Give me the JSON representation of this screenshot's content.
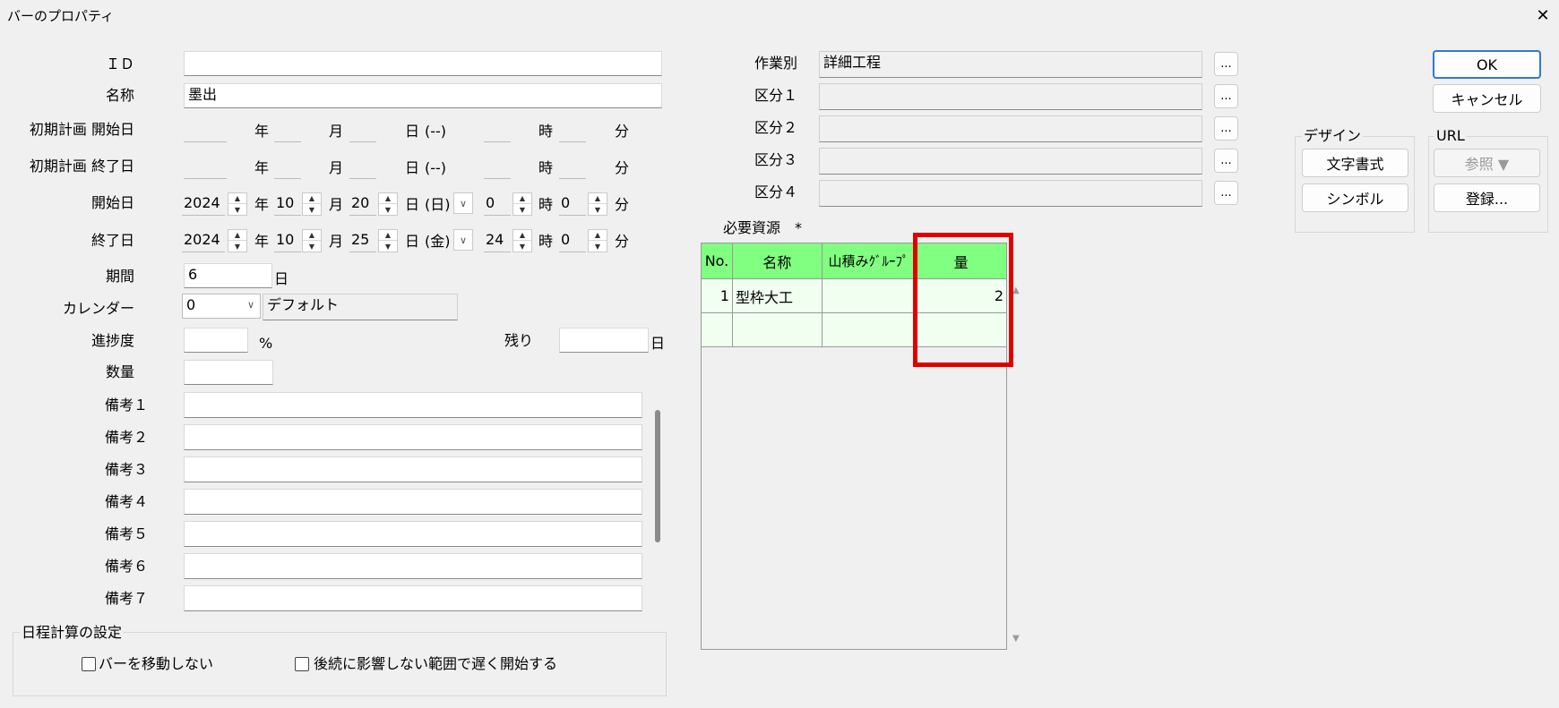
{
  "window": {
    "title": "バーのプロパティ",
    "close_glyph": "✕"
  },
  "left": {
    "id_label": "ＩＤ",
    "id_value": "",
    "name_label": "名称",
    "name_value": "墨出",
    "initial_start_label": "初期計画 開始日",
    "initial_end_label": "初期計画 終了日",
    "start_label": "開始日",
    "end_label": "終了日",
    "unit_year": "年",
    "unit_month": "月",
    "unit_day": "日",
    "unit_hour": "時",
    "unit_min": "分",
    "weekday_empty": "(--)",
    "start": {
      "year": "2024",
      "month": "10",
      "day": "20",
      "weekday": "(日)",
      "hour": "0",
      "min": "0"
    },
    "end": {
      "year": "2024",
      "month": "10",
      "day": "25",
      "weekday": "(金)",
      "hour": "24",
      "min": "0"
    },
    "period_label": "期間",
    "period_value": "6",
    "period_unit": "日",
    "calendar_label": "カレンダー",
    "calendar_value": "0",
    "calendar_name": "デフォルト",
    "progress_label": "進捗度",
    "progress_value": "",
    "progress_unit": "%",
    "remain_label": "残り",
    "remain_value": "",
    "remain_unit": "日",
    "quantity_label": "数量",
    "quantity_value": "",
    "notes": [
      {
        "label": "備考１",
        "value": ""
      },
      {
        "label": "備考２",
        "value": ""
      },
      {
        "label": "備考３",
        "value": ""
      },
      {
        "label": "備考４",
        "value": ""
      },
      {
        "label": "備考５",
        "value": ""
      },
      {
        "label": "備考６",
        "value": ""
      },
      {
        "label": "備考７",
        "value": ""
      }
    ]
  },
  "schedule": {
    "group_title": "日程計算の設定",
    "no_move_label": "バーを移動しない",
    "late_start_label": "後続に影響しない範囲で遅く開始する"
  },
  "middle": {
    "work_type_label": "作業別",
    "work_type_value": "詳細工程",
    "div1_label": "区分１",
    "div2_label": "区分２",
    "div3_label": "区分３",
    "div4_label": "区分４",
    "browse_label": "...",
    "resources_label": "必要資源　*",
    "grid": {
      "headers": [
        "No.",
        "名称",
        "山積みｸﾞﾙｰﾌﾟ",
        "量"
      ],
      "rows": [
        {
          "no": "1",
          "name": "型枠大工",
          "group": "",
          "qty": "2"
        },
        {
          "no": "",
          "name": "",
          "group": "",
          "qty": ""
        }
      ]
    },
    "highlight_color": "#e00000"
  },
  "right": {
    "ok_label": "OK",
    "cancel_label": "キャンセル",
    "design_title": "デザイン",
    "text_format_label": "文字書式",
    "symbol_label": "シンボル",
    "url_title": "URL",
    "browse_url_label": "参照 ▼",
    "register_label": "登録..."
  }
}
